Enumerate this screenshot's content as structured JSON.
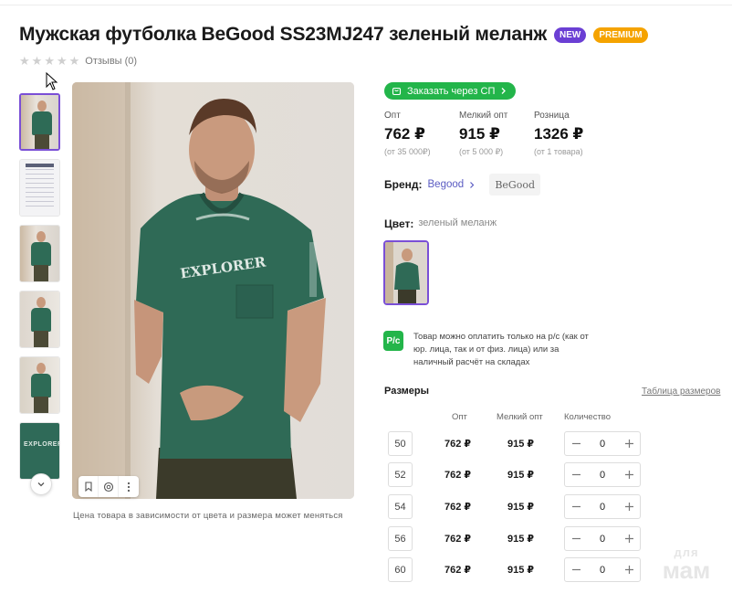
{
  "product": {
    "title": "Мужская футболка BeGood SS23MJ247 зеленый меланж",
    "badges": {
      "new": "NEW",
      "premium": "PREMIUM"
    },
    "reviews_label": "Отзывы (0)",
    "rating_stars": 0
  },
  "gallery": {
    "price_note": "Цена товара в зависимости от цвета и размера может меняться"
  },
  "order": {
    "label": "Заказать через СП"
  },
  "prices": [
    {
      "label": "Опт",
      "value": "762 ₽",
      "sub": "(от 35 000₽)"
    },
    {
      "label": "Мелкий опт",
      "value": "915 ₽",
      "sub": "(от 5 000 ₽)"
    },
    {
      "label": "Розница",
      "value": "1326 ₽",
      "sub": "(от 1 товара)"
    }
  ],
  "brand": {
    "label": "Бренд:",
    "name": "Begood",
    "logo_text": "BeGood"
  },
  "color": {
    "label": "Цвет:",
    "value": "зеленый меланж"
  },
  "payment": {
    "icon_text": "P/c",
    "text": "Товар можно оплатить только на р/с (как от юр. лица, так и от физ. лица) или за наличный расчёт на складах"
  },
  "sizes": {
    "title": "Размеры",
    "table_link": "Таблица размеров",
    "headers": {
      "opt": "Опт",
      "small_opt": "Мелкий опт",
      "qty": "Количество"
    },
    "rows": [
      {
        "size": "50",
        "opt": "762 ₽",
        "small_opt": "915 ₽",
        "qty": "0"
      },
      {
        "size": "52",
        "opt": "762 ₽",
        "small_opt": "915 ₽",
        "qty": "0"
      },
      {
        "size": "54",
        "opt": "762 ₽",
        "small_opt": "915 ₽",
        "qty": "0"
      },
      {
        "size": "56",
        "opt": "762 ₽",
        "small_opt": "915 ₽",
        "qty": "0"
      },
      {
        "size": "60",
        "opt": "762 ₽",
        "small_opt": "915 ₽",
        "qty": "0"
      }
    ]
  },
  "watermark": {
    "top": "для",
    "bottom": "мам"
  },
  "colors": {
    "accent": "#7a4fd6",
    "green": "#23b54a",
    "shirt": "#2e6b56",
    "new_badge": "#6b3fd4",
    "premium_badge": "#f5a300"
  }
}
